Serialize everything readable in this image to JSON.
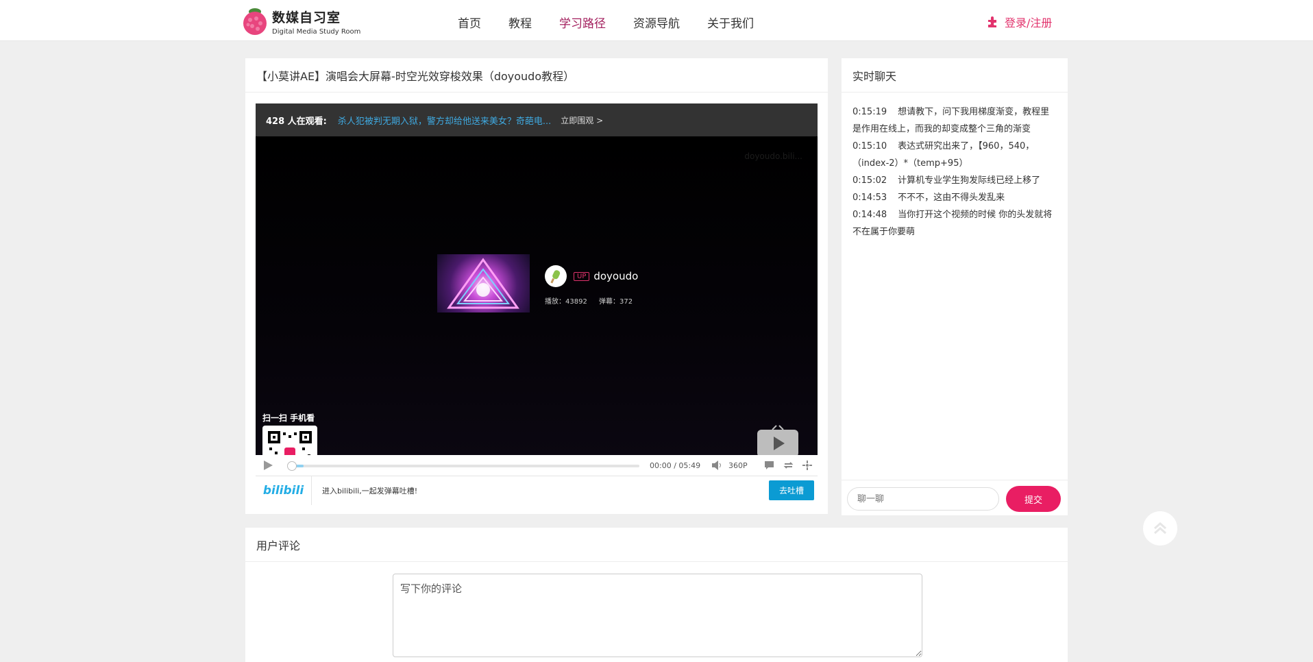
{
  "brand": {
    "title": "数媒自习室",
    "subtitle": "Digital Media Study Room"
  },
  "nav": [
    {
      "label": "首页",
      "active": false
    },
    {
      "label": "教程",
      "active": false
    },
    {
      "label": "学习路径",
      "active": true
    },
    {
      "label": "资源导航",
      "active": false
    },
    {
      "label": "关于我们",
      "active": false
    }
  ],
  "login": {
    "label": "登录/注册",
    "icon": "puzzle-icon"
  },
  "video": {
    "title": "【小莫讲AE】演唱会大屏幕-时空光效穿梭效果（doyoudo教程）",
    "watch_count": "428 人在观看:",
    "watch_link": "杀人犯被判无期入狱，警方却给他送来美女？奇葩电...",
    "watch_go": "立即围观 >",
    "watermark": "doyoudo.bili...",
    "up_tag": "UP",
    "up_name": "doyoudo",
    "plays": "播放：43892",
    "danmaku_count": "弹幕：372",
    "qr_label": "扫一扫 手机看",
    "time_current": "00:00",
    "time_total": "05:49",
    "quality": "360P",
    "bili_logo": "bilibili",
    "danmaku_hint": "进入bilibili,一起发弹幕吐槽!",
    "danmaku_button": "去吐槽",
    "progress": 0.02
  },
  "chat": {
    "title": "实时聊天",
    "messages": [
      {
        "time": "0:15:19",
        "text": "想请教下，问下我用梯度渐变，教程里是作用在线上，而我的却变成整个三角的渐变"
      },
      {
        "time": "0:15:10",
        "text": "表达式研究出来了，【960，540，（index-2）*（temp+95）"
      },
      {
        "time": "0:15:02",
        "text": "计算机专业学生狗发际线已经上移了"
      },
      {
        "time": "0:14:53",
        "text": "不不不，这由不得头发乱来"
      },
      {
        "time": "0:14:48",
        "text": "当你打开这个视频的时候 你的头发就将不在属于你要萌"
      }
    ],
    "input_placeholder": "聊一聊",
    "submit_label": "提交"
  },
  "comments": {
    "title": "用户评论",
    "placeholder": "写下你的评论"
  },
  "colors": {
    "accent": "#e91e63",
    "nav_active": "#a21d5c",
    "bili_blue": "#0b9bd3"
  }
}
